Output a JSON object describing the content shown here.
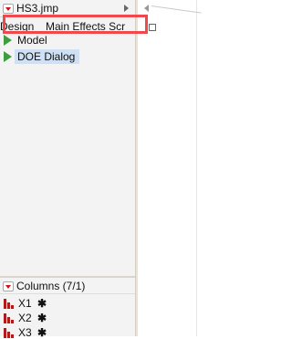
{
  "file": {
    "name": "HS3.jmp"
  },
  "header": {
    "tabs": [
      "Design",
      "Main Effects Scr"
    ]
  },
  "scripts": [
    {
      "label": "Model"
    },
    {
      "label": "DOE Dialog",
      "selected": true
    }
  ],
  "columns": {
    "header": "Columns (7/1)",
    "items": [
      {
        "name": "X1",
        "marker": "✱"
      },
      {
        "name": "X2",
        "marker": "✱"
      },
      {
        "name": "X3",
        "marker": "✱"
      }
    ]
  },
  "colors": {
    "highlight_box": "#f0484c",
    "selection": "#cfe0f5",
    "script_icon": "#3e9e3e",
    "column_icon": "#b31b1b"
  }
}
